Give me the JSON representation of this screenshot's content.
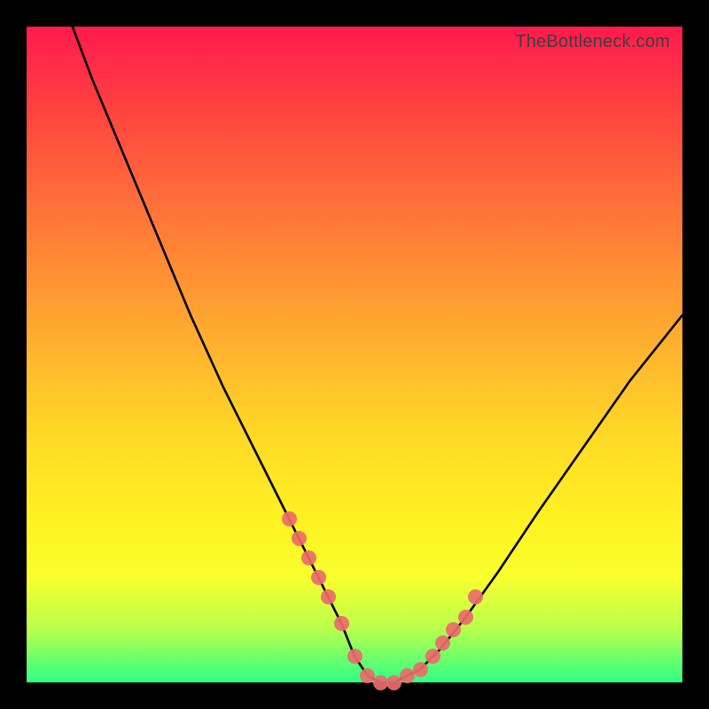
{
  "watermark": "TheBottleneck.com",
  "chart_data": {
    "type": "line",
    "title": "",
    "xlabel": "",
    "ylabel": "",
    "xlim": [
      0,
      100
    ],
    "ylim": [
      0,
      100
    ],
    "grid": false,
    "background_gradient": [
      "#ff1a4d",
      "#ff6a3a",
      "#ffb52e",
      "#fff322",
      "#2eff86"
    ],
    "series": [
      {
        "name": "bottleneck-curve",
        "color": "#000000",
        "x": [
          7,
          10,
          15,
          20,
          25,
          30,
          35,
          40,
          45,
          48,
          50,
          52,
          54,
          56,
          58,
          60,
          63,
          67,
          72,
          78,
          85,
          92,
          100
        ],
        "values": [
          100,
          92,
          80,
          68,
          56,
          45,
          35,
          25,
          15,
          9,
          4,
          1,
          0,
          0,
          1,
          2,
          5,
          10,
          17,
          26,
          36,
          46,
          56
        ]
      }
    ],
    "highlight_points": {
      "name": "highlight-dots",
      "color": "#ec6b6b",
      "x": [
        40,
        41.5,
        43,
        44.5,
        46,
        48,
        50,
        52,
        54,
        56,
        58,
        60,
        62,
        63.5,
        65,
        67,
        68.5
      ],
      "values": [
        25,
        22,
        19,
        16,
        13,
        9,
        4,
        1,
        0,
        0,
        1,
        2,
        4,
        6,
        8,
        10,
        13
      ]
    }
  }
}
